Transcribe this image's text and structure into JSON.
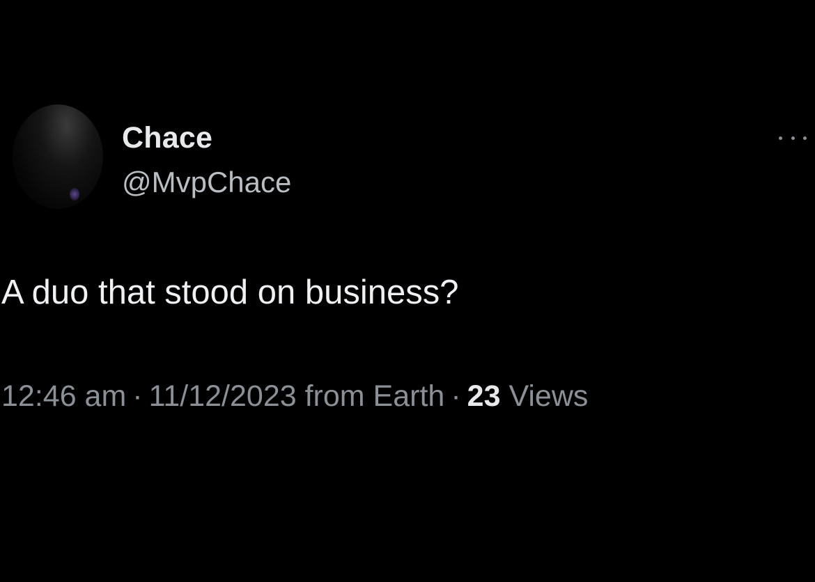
{
  "tweet": {
    "author": {
      "display_name": "Chace",
      "handle": "@MvpChace"
    },
    "text": "A duo that stood on business?",
    "meta": {
      "time": "12:46 am",
      "separator": "·",
      "date": "11/12/2023",
      "source": "from Earth",
      "views_count": "23",
      "views_label": "Views"
    },
    "more_icon": "more-horizontal-icon"
  },
  "colors": {
    "background": "#000000",
    "primary_text": "#e7e9ea",
    "secondary_text": "#8b9096"
  }
}
